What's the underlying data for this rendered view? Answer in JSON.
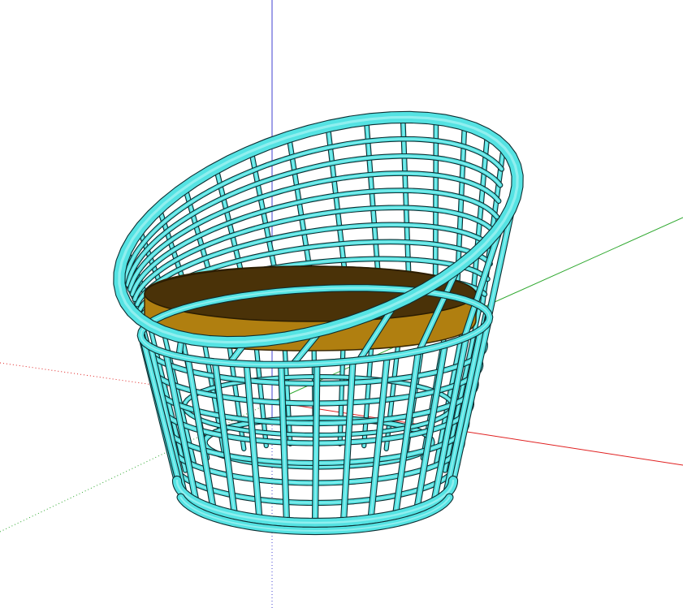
{
  "scene": {
    "subject": "wire-basket-chair",
    "colors": {
      "frame": "#55E3E3",
      "frame_shadow": "#1F7E84",
      "frame_dark": "#0C2E31",
      "seat_top": "#4A3208",
      "seat_side": "#B07F10",
      "axis_red": "#E02020",
      "axis_green": "#2EA82E",
      "axis_blue": "#4040D0",
      "background": "#FFFFFF"
    },
    "axes": {
      "red": "solid-right-dotted-left",
      "green": "solid-upper-right-dotted-lower-left",
      "blue": "solid-up-dotted-down"
    }
  }
}
